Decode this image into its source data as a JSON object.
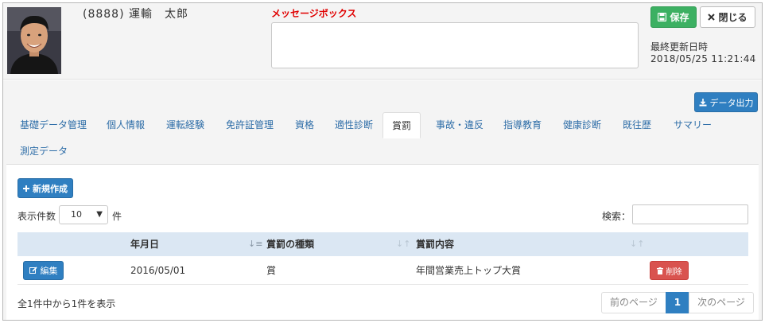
{
  "header": {
    "employee_name": "(8888) 運輸　太郎",
    "message_label": "メッセージボックス",
    "save_label": "保存",
    "close_label": "閉じる",
    "last_updated_label": "最終更新日時",
    "last_updated_value": "2018/05/25 11:21:44"
  },
  "toolbar": {
    "export_label": "データ出力"
  },
  "tabs": [
    {
      "label": "基礎データ管理",
      "active": false
    },
    {
      "label": "個人情報",
      "active": false
    },
    {
      "label": "運転経験",
      "active": false
    },
    {
      "label": "免許証管理",
      "active": false
    },
    {
      "label": "資格",
      "active": false
    },
    {
      "label": "適性診断",
      "active": false
    },
    {
      "label": "賞罰",
      "active": true
    },
    {
      "label": "事故・違反",
      "active": false
    },
    {
      "label": "指導教育",
      "active": false
    },
    {
      "label": "健康診断",
      "active": false
    },
    {
      "label": "既往歴",
      "active": false
    },
    {
      "label": "サマリー",
      "active": false
    },
    {
      "label": "測定データ",
      "active": false
    }
  ],
  "content": {
    "new_label": "新規作成",
    "length_label": "表示件数",
    "length_value": "10",
    "length_unit": "件",
    "search_label": "検索：",
    "search_value": ""
  },
  "table": {
    "columns": [
      "年月日",
      "賞罰の種類",
      "賞罰内容"
    ],
    "rows": [
      {
        "edit_label": "編集",
        "date": "2016/05/01",
        "type": "賞",
        "content": "年間営業売上トップ大賞",
        "delete_label": "削除"
      }
    ]
  },
  "footer": {
    "info": "全1件中から1件を表示",
    "prev_label": "前のページ",
    "current_page": "1",
    "next_label": "次のページ"
  },
  "colors": {
    "primary": "#2f7fc1",
    "success": "#3cb062",
    "danger": "#d9534f",
    "message_label": "#e00000",
    "table_header": "#dbe7f3"
  }
}
